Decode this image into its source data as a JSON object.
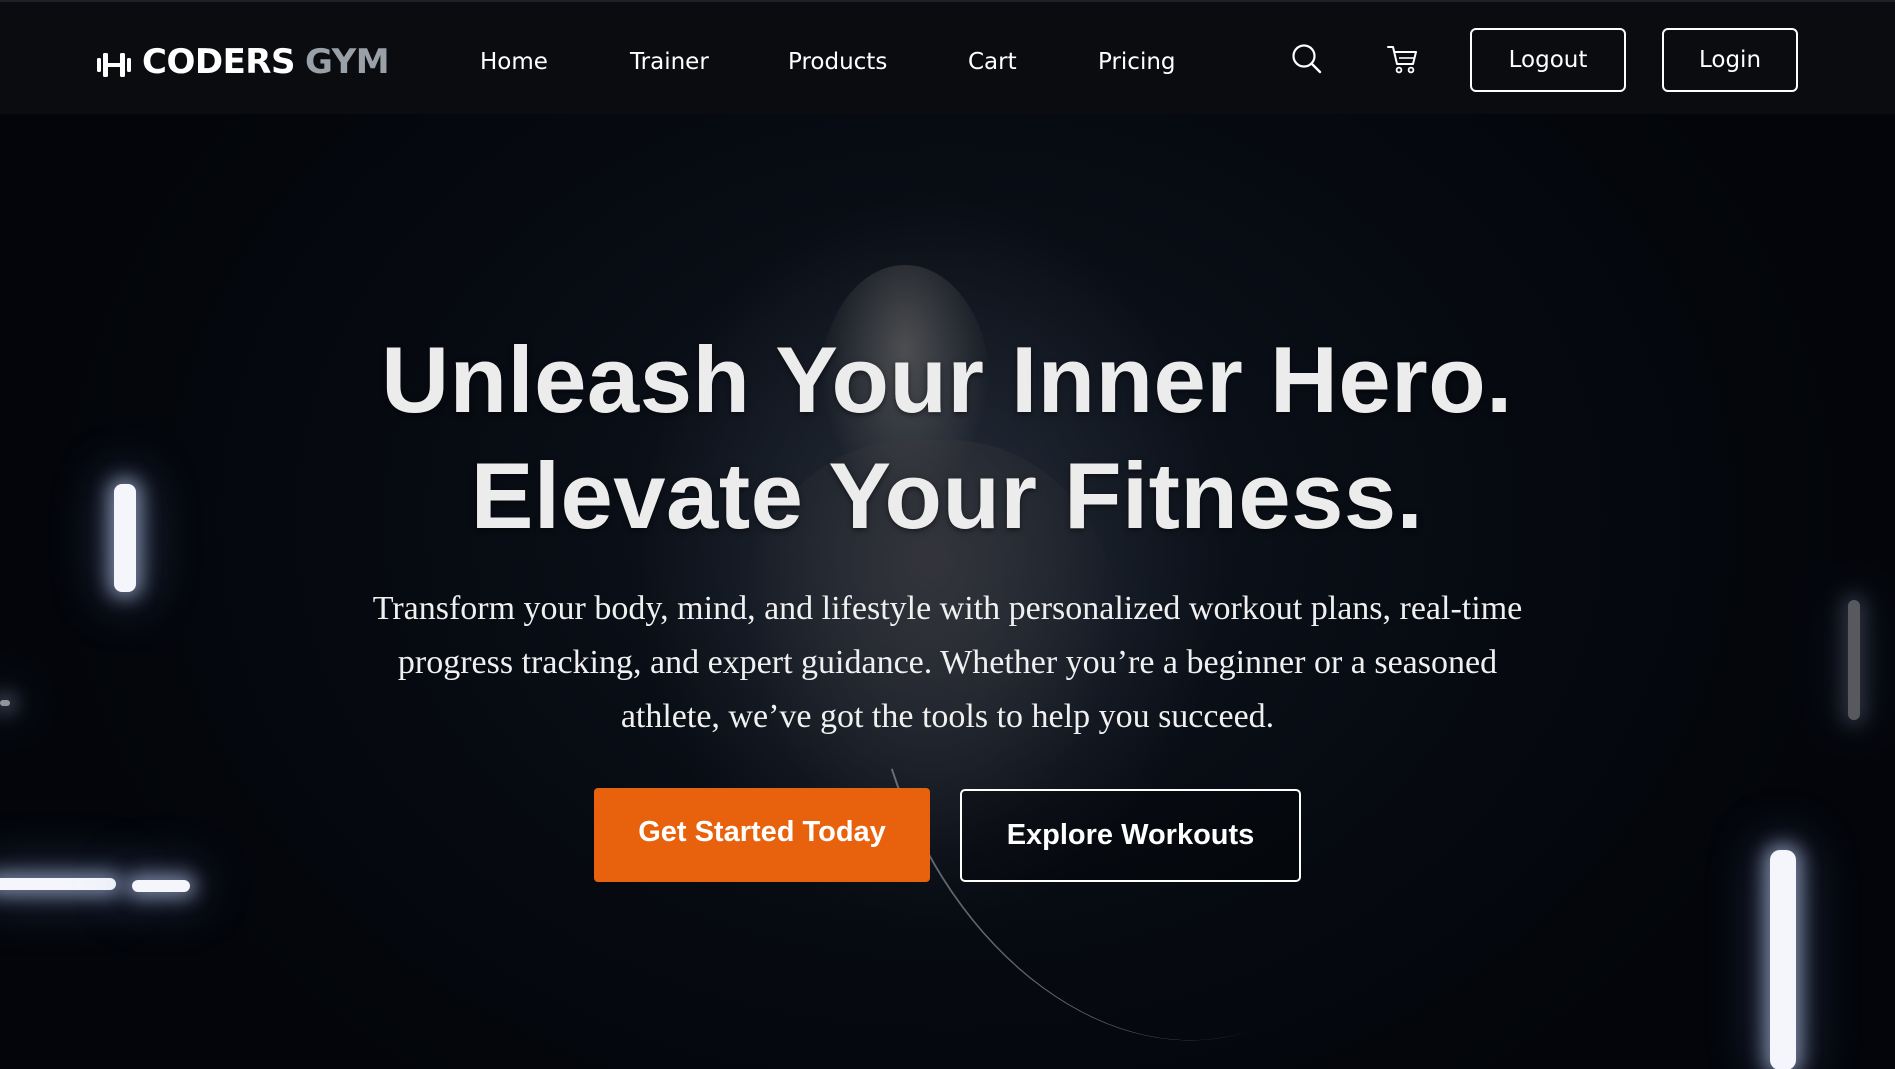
{
  "brand": {
    "name_primary": "CODERS",
    "name_secondary": "GYM",
    "icon": "dumbbell-icon"
  },
  "nav": {
    "links": [
      "Home",
      "Trainer",
      "Products",
      "Cart",
      "Pricing"
    ],
    "search_icon": "search-icon",
    "cart_icon": "shopping-cart-icon",
    "logout_label": "Logout",
    "login_label": "Login"
  },
  "hero": {
    "title_line1": "Unleash Your Inner Hero.",
    "title_line2": "Elevate Your Fitness.",
    "subtitle": "Transform your body, mind, and lifestyle with personalized workout plans, real-time progress tracking, and expert guidance. Whether you’re a beginner or a seasoned athlete, we’ve got the tools to help you succeed.",
    "cta_primary": "Get Started Today",
    "cta_secondary": "Explore Workouts"
  },
  "colors": {
    "accent": "#e8610c",
    "navbar_bg": "#0a0c10",
    "text": "#ffffff",
    "brand_secondary": "#9aa0a8"
  }
}
